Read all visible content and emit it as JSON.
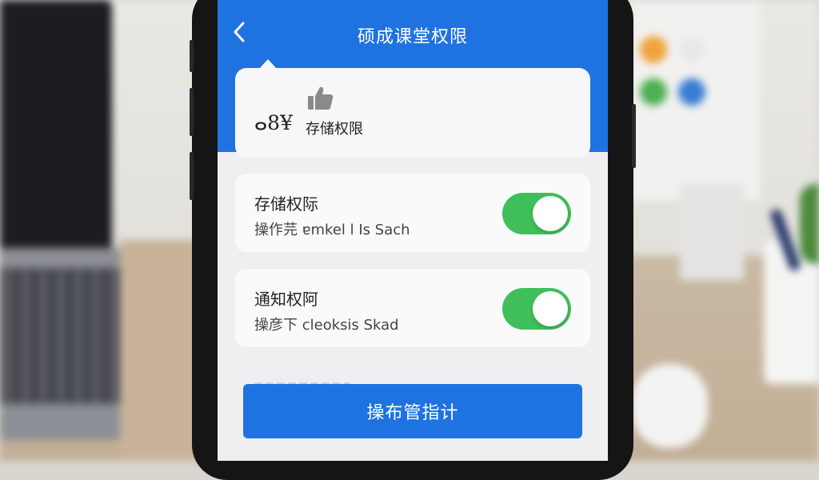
{
  "header": {
    "title": "硕成课堂权限",
    "back_icon": "chevron-left-icon",
    "color": "#1f73e1"
  },
  "top_card": {
    "icon": "thumbs-up-icon",
    "symbol_text": "ⴰ8¥",
    "label": "存储权限"
  },
  "settings": [
    {
      "title": "存储权际",
      "subtitle": "操作芫 ɐmkel l Is Sach",
      "toggle_on": true
    },
    {
      "title": "通知权阿",
      "subtitle": "操彦下 cleoksis Skad",
      "toggle_on": true
    }
  ],
  "primary_button": {
    "label": "操布管指计"
  },
  "colors": {
    "accent": "#1f73e1",
    "toggle_on": "#3fbf5a",
    "background": "#efeff2"
  }
}
